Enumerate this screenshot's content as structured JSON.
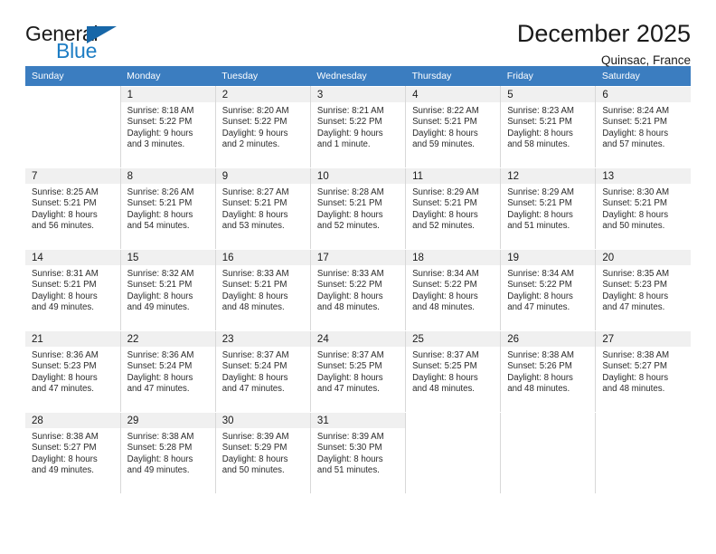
{
  "brand": {
    "word_one": "General",
    "word_two": "Blue",
    "flag_icon": "triangle-flag-icon",
    "accent_color": "#1767a8"
  },
  "header": {
    "title": "December 2025",
    "location": "Quinsac, France"
  },
  "calendar": {
    "header_bg": "#3b7dc0",
    "daynum_bg": "#f0f0f0",
    "weekday_headers": [
      "Sunday",
      "Monday",
      "Tuesday",
      "Wednesday",
      "Thursday",
      "Friday",
      "Saturday"
    ],
    "weeks": [
      [
        {
          "day": "",
          "info": ""
        },
        {
          "day": "1",
          "info": "Sunrise: 8:18 AM\nSunset: 5:22 PM\nDaylight: 9 hours\nand 3 minutes."
        },
        {
          "day": "2",
          "info": "Sunrise: 8:20 AM\nSunset: 5:22 PM\nDaylight: 9 hours\nand 2 minutes."
        },
        {
          "day": "3",
          "info": "Sunrise: 8:21 AM\nSunset: 5:22 PM\nDaylight: 9 hours\nand 1 minute."
        },
        {
          "day": "4",
          "info": "Sunrise: 8:22 AM\nSunset: 5:21 PM\nDaylight: 8 hours\nand 59 minutes."
        },
        {
          "day": "5",
          "info": "Sunrise: 8:23 AM\nSunset: 5:21 PM\nDaylight: 8 hours\nand 58 minutes."
        },
        {
          "day": "6",
          "info": "Sunrise: 8:24 AM\nSunset: 5:21 PM\nDaylight: 8 hours\nand 57 minutes."
        }
      ],
      [
        {
          "day": "7",
          "info": "Sunrise: 8:25 AM\nSunset: 5:21 PM\nDaylight: 8 hours\nand 56 minutes."
        },
        {
          "day": "8",
          "info": "Sunrise: 8:26 AM\nSunset: 5:21 PM\nDaylight: 8 hours\nand 54 minutes."
        },
        {
          "day": "9",
          "info": "Sunrise: 8:27 AM\nSunset: 5:21 PM\nDaylight: 8 hours\nand 53 minutes."
        },
        {
          "day": "10",
          "info": "Sunrise: 8:28 AM\nSunset: 5:21 PM\nDaylight: 8 hours\nand 52 minutes."
        },
        {
          "day": "11",
          "info": "Sunrise: 8:29 AM\nSunset: 5:21 PM\nDaylight: 8 hours\nand 52 minutes."
        },
        {
          "day": "12",
          "info": "Sunrise: 8:29 AM\nSunset: 5:21 PM\nDaylight: 8 hours\nand 51 minutes."
        },
        {
          "day": "13",
          "info": "Sunrise: 8:30 AM\nSunset: 5:21 PM\nDaylight: 8 hours\nand 50 minutes."
        }
      ],
      [
        {
          "day": "14",
          "info": "Sunrise: 8:31 AM\nSunset: 5:21 PM\nDaylight: 8 hours\nand 49 minutes."
        },
        {
          "day": "15",
          "info": "Sunrise: 8:32 AM\nSunset: 5:21 PM\nDaylight: 8 hours\nand 49 minutes."
        },
        {
          "day": "16",
          "info": "Sunrise: 8:33 AM\nSunset: 5:21 PM\nDaylight: 8 hours\nand 48 minutes."
        },
        {
          "day": "17",
          "info": "Sunrise: 8:33 AM\nSunset: 5:22 PM\nDaylight: 8 hours\nand 48 minutes."
        },
        {
          "day": "18",
          "info": "Sunrise: 8:34 AM\nSunset: 5:22 PM\nDaylight: 8 hours\nand 48 minutes."
        },
        {
          "day": "19",
          "info": "Sunrise: 8:34 AM\nSunset: 5:22 PM\nDaylight: 8 hours\nand 47 minutes."
        },
        {
          "day": "20",
          "info": "Sunrise: 8:35 AM\nSunset: 5:23 PM\nDaylight: 8 hours\nand 47 minutes."
        }
      ],
      [
        {
          "day": "21",
          "info": "Sunrise: 8:36 AM\nSunset: 5:23 PM\nDaylight: 8 hours\nand 47 minutes."
        },
        {
          "day": "22",
          "info": "Sunrise: 8:36 AM\nSunset: 5:24 PM\nDaylight: 8 hours\nand 47 minutes."
        },
        {
          "day": "23",
          "info": "Sunrise: 8:37 AM\nSunset: 5:24 PM\nDaylight: 8 hours\nand 47 minutes."
        },
        {
          "day": "24",
          "info": "Sunrise: 8:37 AM\nSunset: 5:25 PM\nDaylight: 8 hours\nand 47 minutes."
        },
        {
          "day": "25",
          "info": "Sunrise: 8:37 AM\nSunset: 5:25 PM\nDaylight: 8 hours\nand 48 minutes."
        },
        {
          "day": "26",
          "info": "Sunrise: 8:38 AM\nSunset: 5:26 PM\nDaylight: 8 hours\nand 48 minutes."
        },
        {
          "day": "27",
          "info": "Sunrise: 8:38 AM\nSunset: 5:27 PM\nDaylight: 8 hours\nand 48 minutes."
        }
      ],
      [
        {
          "day": "28",
          "info": "Sunrise: 8:38 AM\nSunset: 5:27 PM\nDaylight: 8 hours\nand 49 minutes."
        },
        {
          "day": "29",
          "info": "Sunrise: 8:38 AM\nSunset: 5:28 PM\nDaylight: 8 hours\nand 49 minutes."
        },
        {
          "day": "30",
          "info": "Sunrise: 8:39 AM\nSunset: 5:29 PM\nDaylight: 8 hours\nand 50 minutes."
        },
        {
          "day": "31",
          "info": "Sunrise: 8:39 AM\nSunset: 5:30 PM\nDaylight: 8 hours\nand 51 minutes."
        },
        {
          "day": "",
          "info": ""
        },
        {
          "day": "",
          "info": ""
        },
        {
          "day": "",
          "info": ""
        }
      ]
    ]
  }
}
